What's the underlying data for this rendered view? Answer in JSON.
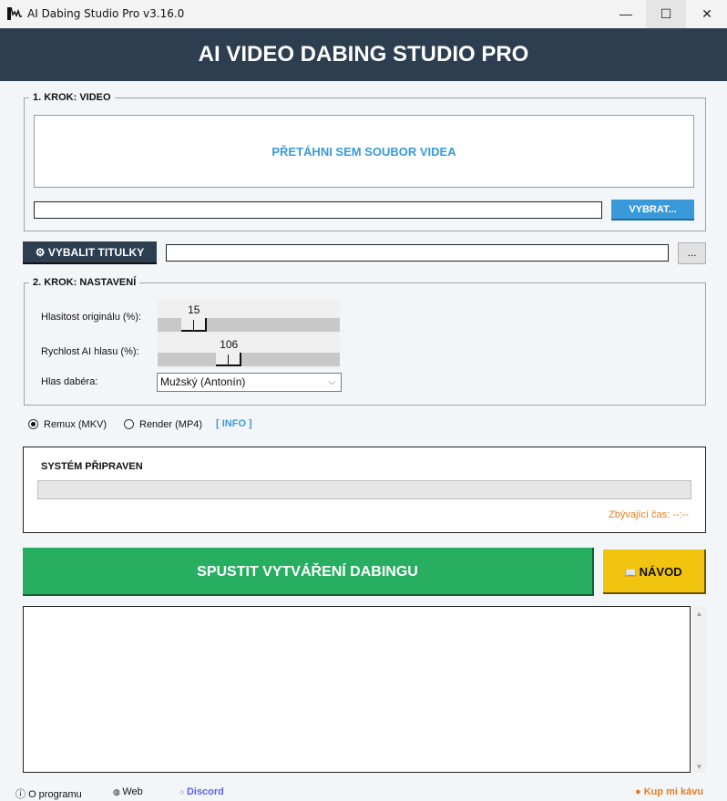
{
  "window": {
    "title": "AI Dabing Studio Pro v3.16.0",
    "minimize": "—",
    "maximize": "☐",
    "close": "✕"
  },
  "header": {
    "title": "AI VIDEO DABING STUDIO PRO"
  },
  "step1": {
    "legend": "1. KROK: VIDEO",
    "drop_text": "PŘETÁHNI SEM SOUBOR VIDEA",
    "path_value": "",
    "browse_label": "VYBRAT..."
  },
  "subs": {
    "button_label": "VYBALIT TITULKY",
    "path_value": "",
    "browse_label": "..."
  },
  "step2": {
    "legend": "2. KROK: NASTAVENÍ",
    "volume": {
      "label": "Hlasitost originálu (%):",
      "value": 15
    },
    "speed": {
      "label": "Rychlost AI hlasu (%):",
      "value": 106
    },
    "voice": {
      "label": "Hlas dabéra:",
      "selected": "Mužský (Antonín)"
    }
  },
  "output": {
    "options": [
      {
        "label": "Remux (MKV)",
        "checked": true
      },
      {
        "label": "Render (MP4)",
        "checked": false
      }
    ],
    "info_link": "[ INFO ]"
  },
  "status": {
    "title": "SYSTÉM PŘIPRAVEN",
    "progress": 0,
    "remaining": "Zbývající čas: --:--"
  },
  "actions": {
    "start_label": "SPUSTIT VYTVÁŘENÍ DABINGU",
    "guide_label": "NÁVOD"
  },
  "log": {
    "text": ""
  },
  "footer": {
    "about": "O programu",
    "web": "Web",
    "discord": "Discord",
    "coffee": "Kup mi kávu"
  },
  "colors": {
    "header": "#2c3e50",
    "accent": "#3a9ad9",
    "start": "#27ae60",
    "guide": "#f1c40f",
    "remaining": "#e67e22",
    "discord": "#5865f2"
  }
}
